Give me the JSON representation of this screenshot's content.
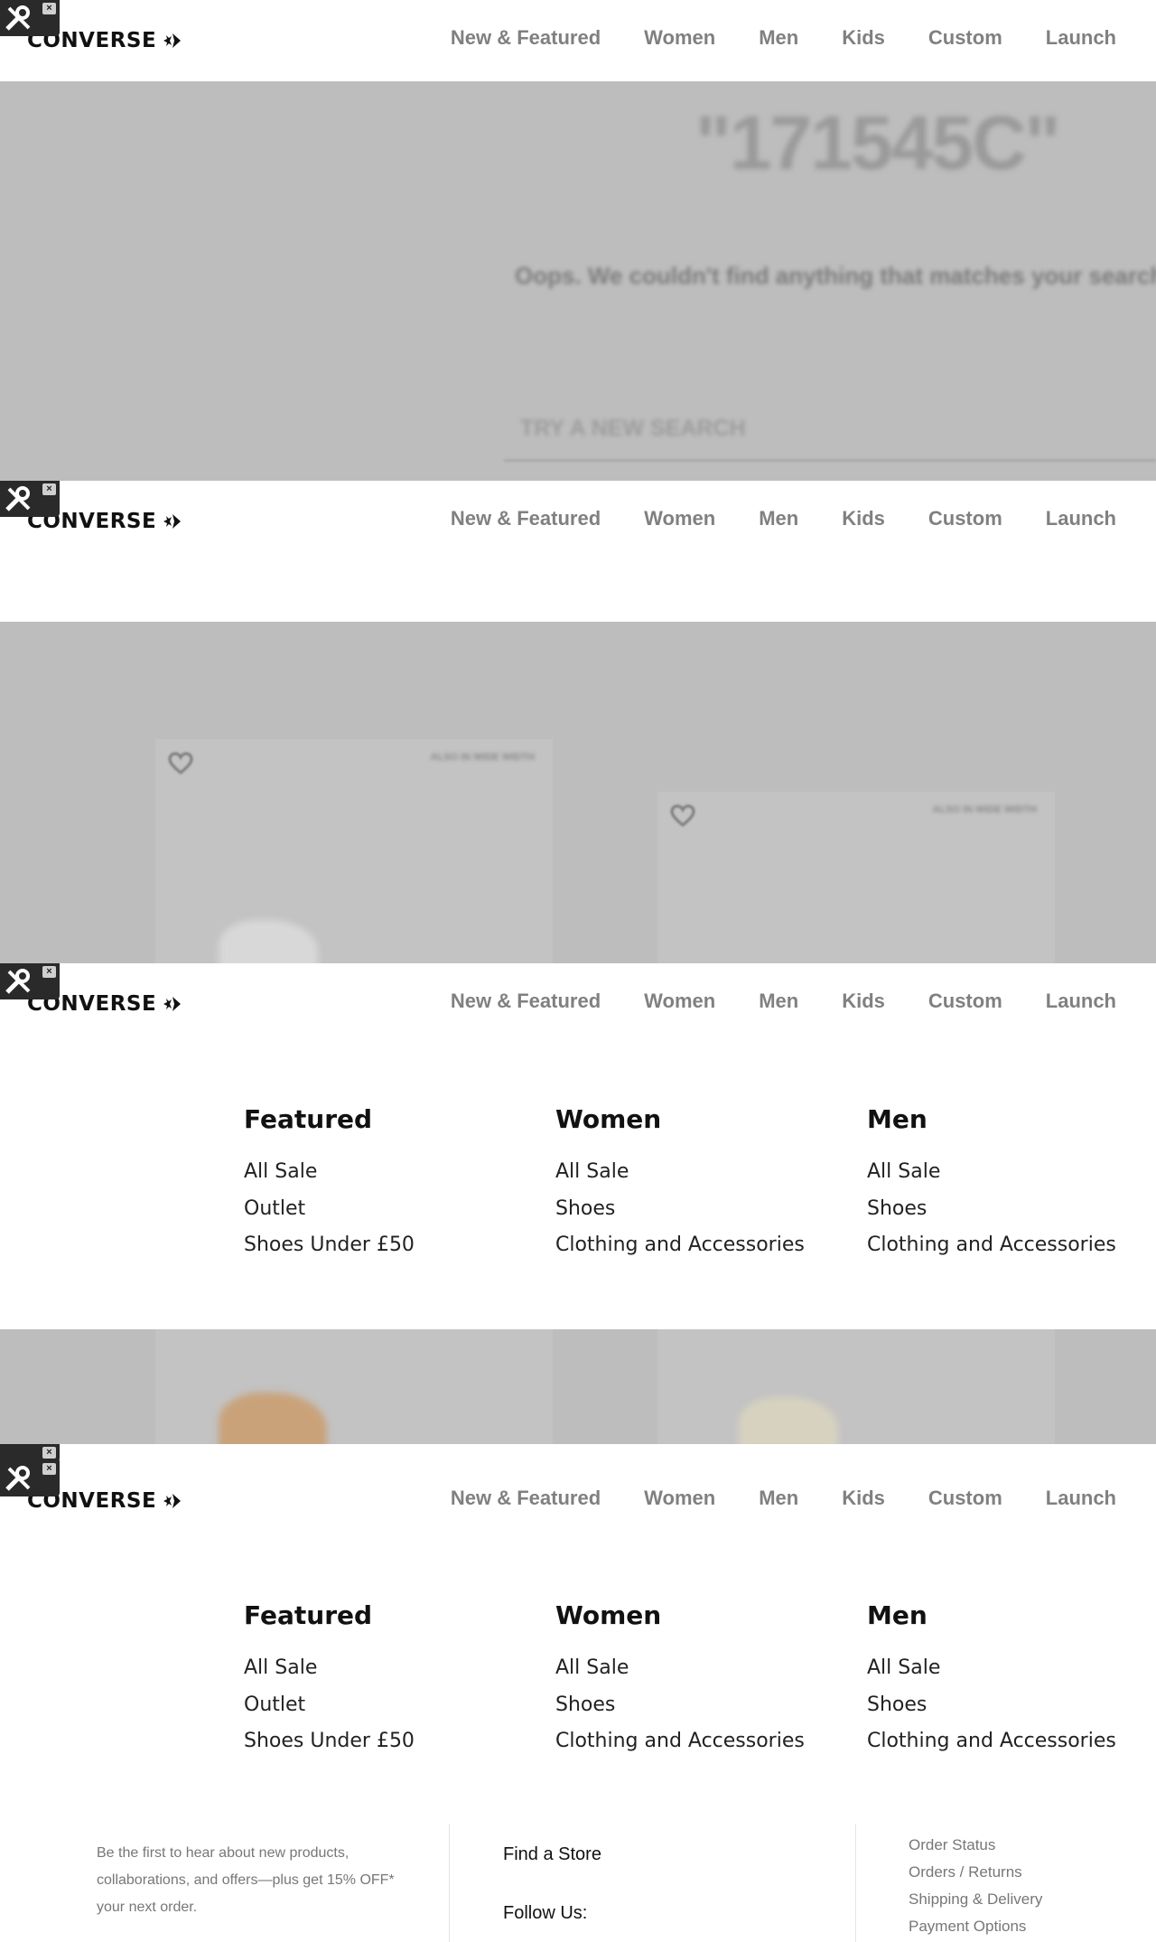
{
  "brand": {
    "logo_text": "CONVERSE"
  },
  "nav": [
    "New & Featured",
    "Women",
    "Men",
    "Kids",
    "Custom",
    "Launch"
  ],
  "search": {
    "query": "\"171545C\"",
    "message": "Oops. We couldn't find anything that matches your search",
    "placeholder": "TRY A NEW SEARCH"
  },
  "products": [
    {
      "badge": "ALSO IN WIDE WIDTH"
    },
    {
      "badge": "ALSO IN WIDE WIDTH"
    }
  ],
  "menu": [
    {
      "title": "Featured",
      "items": [
        "All Sale",
        "Outlet",
        "Shoes Under £50"
      ]
    },
    {
      "title": "Women",
      "items": [
        "All Sale",
        "Shoes",
        "Clothing and Accessories"
      ]
    },
    {
      "title": "Men",
      "items": [
        "All Sale",
        "Shoes",
        "Clothing and Accessories"
      ]
    }
  ],
  "footer": {
    "newsletter": "Be the first to hear about new products, collaborations, and offers—plus get 15% OFF* your next order.",
    "find_store": "Find a Store",
    "follow_us": "Follow Us:",
    "help_links": [
      "Order Status",
      "Orders / Returns",
      "Shipping & Delivery",
      "Payment Options"
    ]
  },
  "colors": {
    "overlay_grey": "#bdbdbd",
    "nav_grey": "#808080"
  }
}
